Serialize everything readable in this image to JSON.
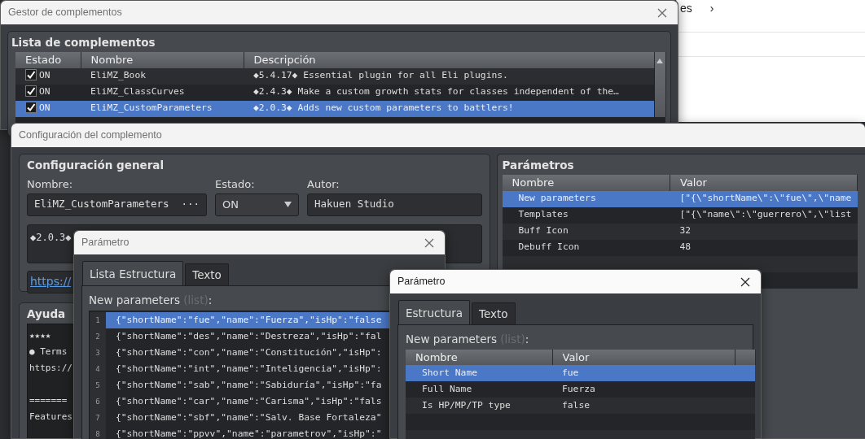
{
  "background_app": {
    "texts": [
      "es",
      "›"
    ]
  },
  "plugin_manager": {
    "title": "Gestor de complementos",
    "list_title": "Lista de complementos",
    "columns": [
      "Estado",
      "Nombre",
      "Descripción"
    ],
    "rows": [
      {
        "checked": true,
        "status": "ON",
        "name": "EliMZ_Book",
        "description": "◆5.4.17◆ Essential plugin for all Eli plugins.",
        "selected": false
      },
      {
        "checked": true,
        "status": "ON",
        "name": "EliMZ_ClassCurves",
        "description": "◆2.4.3◆ Make a custom growth stats for classes independent of the…",
        "selected": false
      },
      {
        "checked": true,
        "status": "ON",
        "name": "EliMZ_CustomParameters",
        "description": "◆2.0.3◆ Adds new custom parameters to battlers!",
        "selected": true
      }
    ]
  },
  "plugin_config": {
    "title": "Configuración del complemento",
    "general": {
      "title": "Configuración general",
      "name_label": "Nombre:",
      "name_value": "EliMZ_CustomParameters",
      "browse": "···",
      "status_label": "Estado:",
      "status_value": "ON",
      "author_label": "Autor:",
      "author_value": "Hakuen Studio",
      "description": "◆2.0.3◆",
      "link": "https://"
    },
    "help": {
      "title": "Ayuda",
      "paragraphs": [
        [
          "★★★★",
          "● Terms",
          "https://"
        ],
        [
          "=======",
          "Features"
        ]
      ]
    },
    "parameters": {
      "title": "Parámetros",
      "columns": [
        "Nombre",
        "Valor"
      ],
      "rows": [
        {
          "name": "New parameters",
          "value": "[\"{\\\"shortName\\\":\\\"fue\\\",\\\"name",
          "selected": true
        },
        {
          "name": "Templates",
          "value": "[\"{\\\"name\\\":\\\"guerrero\\\",\\\"list",
          "selected": false
        },
        {
          "name": "Buff Icon",
          "value": "32",
          "selected": false
        },
        {
          "name": "Debuff Icon",
          "value": "48",
          "selected": false
        }
      ]
    }
  },
  "list_dialog": {
    "title": "Parámetro",
    "tabs": [
      {
        "label": "Lista Estructura",
        "selected": true
      },
      {
        "label": "Texto",
        "selected": false
      }
    ],
    "label": "New parameters",
    "hint": "(list)",
    "suffix": ":",
    "lines": [
      {
        "number": "1",
        "text": "{\"shortName\":\"fue\",\"name\":\"Fuerza\",\"isHp\":\"false",
        "selected": true
      },
      {
        "number": "2",
        "text": "{\"shortName\":\"des\",\"name\":\"Destreza\",\"isHp\":\"fal",
        "selected": false
      },
      {
        "number": "3",
        "text": "{\"shortName\":\"con\",\"name\":\"Constitución\",\"isHp\":",
        "selected": false
      },
      {
        "number": "4",
        "text": "{\"shortName\":\"int\",\"name\":\"Inteligencia\",\"isHp\":",
        "selected": false
      },
      {
        "number": "5",
        "text": "{\"shortName\":\"sab\",\"name\":\"Sabiduría\",\"isHp\":\"fa",
        "selected": false
      },
      {
        "number": "6",
        "text": "{\"shortName\":\"car\",\"name\":\"Carisma\",\"isHp\":\"fals",
        "selected": false
      },
      {
        "number": "7",
        "text": "{\"shortName\":\"sbf\",\"name\":\"Salv. Base Fortaleza\"",
        "selected": false
      },
      {
        "number": "8",
        "text": "{\"shortName\":\"ppvv\",\"name\":\"parametrov\",\"isHp\":\"",
        "selected": false
      }
    ]
  },
  "struct_dialog": {
    "title": "Parámetro",
    "tabs": [
      {
        "label": "Estructura",
        "selected": true
      },
      {
        "label": "Texto",
        "selected": false
      }
    ],
    "label": "New parameters",
    "hint": "(list)",
    "suffix": ":",
    "columns": [
      "Nombre",
      "Valor"
    ],
    "rows": [
      {
        "name": "Short Name",
        "value": "fue",
        "selected": true
      },
      {
        "name": "Full Name",
        "value": "Fuerza",
        "selected": false
      },
      {
        "name": "Is HP/MP/TP type",
        "value": "false",
        "selected": false
      }
    ]
  }
}
